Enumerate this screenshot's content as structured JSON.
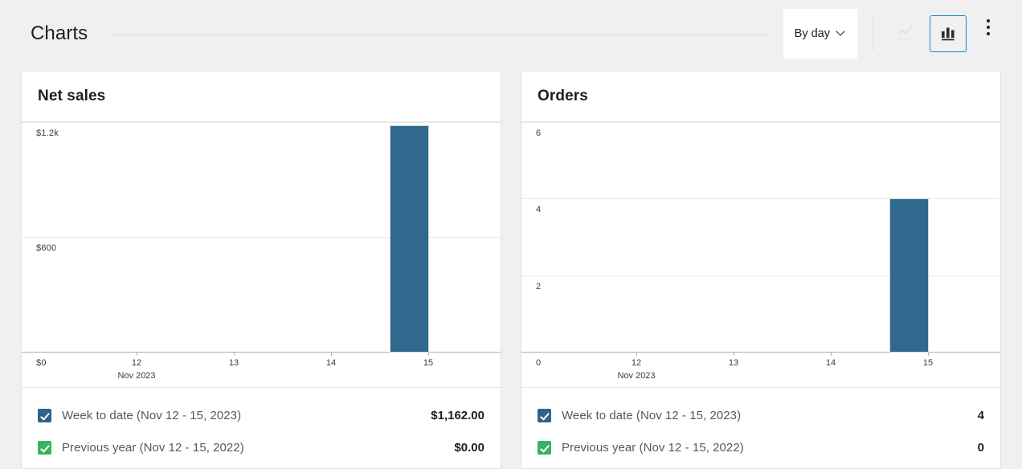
{
  "header": {
    "title": "Charts",
    "interval_select": {
      "label": "By day",
      "chevron_icon": "chevron-down-icon"
    },
    "line_chart_icon": "line-chart-icon",
    "bar_chart_icon": "bar-chart-icon",
    "menu_icon": "ellipsis-vertical-icon",
    "active_chart_type": "bar",
    "accent_color": "#1a87d6"
  },
  "colors": {
    "bar_primary": "#30688e",
    "legend_primary": "#2f6389",
    "legend_secondary": "#3ab35f",
    "gridline": "#e8e8e8",
    "axis": "#b0b0b0",
    "page_background": "#f0f0f0"
  },
  "cards": [
    {
      "title": "Net sales",
      "legend": [
        {
          "label": "Week to date (Nov 12 - 15, 2023)",
          "value": "$1,162.00",
          "color_key": "primary",
          "checked": true
        },
        {
          "label": "Previous year (Nov 12 - 15, 2022)",
          "value": "$0.00",
          "color_key": "secondary",
          "checked": true
        }
      ]
    },
    {
      "title": "Orders",
      "legend": [
        {
          "label": "Week to date (Nov 12 - 15, 2023)",
          "value": "4",
          "color_key": "primary",
          "checked": true
        },
        {
          "label": "Previous year (Nov 12 - 15, 2022)",
          "value": "0",
          "color_key": "secondary",
          "checked": true
        }
      ]
    }
  ],
  "chart_data": [
    {
      "type": "bar",
      "title": "Net sales",
      "xlabel": "Nov 2023",
      "ylabel": "",
      "categories": [
        "12",
        "13",
        "14",
        "15"
      ],
      "x_sublabel_index": 0,
      "x_sublabel": "Nov 2023",
      "ytick_labels": [
        "$1.2k",
        "$600",
        "$0"
      ],
      "ytick_values": [
        1200,
        600,
        0
      ],
      "ylim": [
        0,
        1200
      ],
      "grid": true,
      "legend_position": "bottom",
      "series": [
        {
          "name": "Week to date (Nov 12 - 15, 2023)",
          "total": 1162.0,
          "values": [
            0,
            0,
            0,
            1162.0
          ]
        },
        {
          "name": "Previous year (Nov 12 - 15, 2022)",
          "total": 0.0,
          "values": [
            0,
            0,
            0,
            0
          ]
        }
      ]
    },
    {
      "type": "bar",
      "title": "Orders",
      "xlabel": "Nov 2023",
      "ylabel": "",
      "categories": [
        "12",
        "13",
        "14",
        "15"
      ],
      "x_sublabel_index": 0,
      "x_sublabel": "Nov 2023",
      "ytick_labels": [
        "6",
        "4",
        "2",
        "0"
      ],
      "ytick_values": [
        6,
        4,
        2,
        0
      ],
      "ylim": [
        0,
        6
      ],
      "grid": true,
      "legend_position": "bottom",
      "series": [
        {
          "name": "Week to date (Nov 12 - 15, 2023)",
          "total": 4,
          "values": [
            0,
            0,
            0,
            4
          ]
        },
        {
          "name": "Previous year (Nov 12 - 15, 2022)",
          "total": 0,
          "values": [
            0,
            0,
            0,
            0
          ]
        }
      ]
    }
  ]
}
